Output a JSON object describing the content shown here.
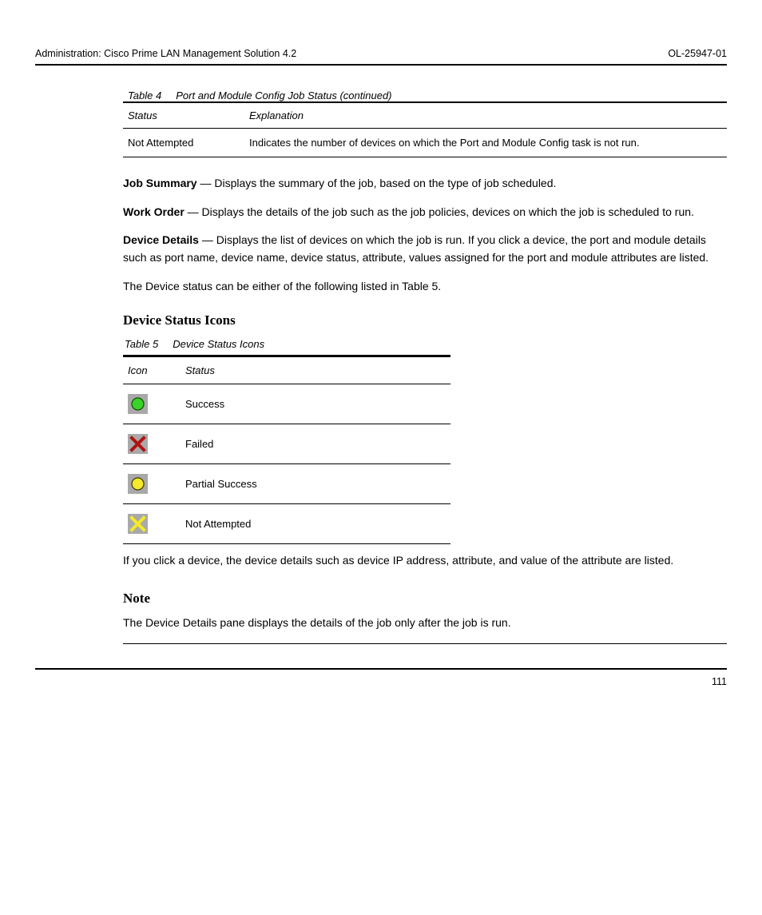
{
  "header": {
    "left": "Administration: Cisco Prime LAN Management Solution 4.2",
    "right": "OL-25947-01"
  },
  "table4": {
    "caption_prefix": "Table 4",
    "caption": "Port and Module Config Job Status (continued)",
    "columns": [
      "Status",
      "Explanation"
    ],
    "row": {
      "status": "Not Attempted",
      "explanation": "Indicates the number of devices on which the Port and Module Config task is not run."
    }
  },
  "paragraphs": [
    {
      "label": "Job Summary",
      "text": " — Displays the summary of the job, based on the type of job scheduled."
    },
    {
      "label": "Work Order",
      "text": " — Displays the details of the job such as the job policies, devices on which the job is scheduled to run."
    },
    {
      "label": "Device Details",
      "text": " — Displays the list of devices on which the job is run. If you click a device, the port and module details such as port name, device name, device status, attribute, values assigned for the port and module attributes are listed."
    },
    {
      "label": null,
      "text": "The Device status can be either of the following listed in Table 5."
    }
  ],
  "sections": {
    "iconTableHeading": "Device Status Icons",
    "iconTable": {
      "caption_prefix": "Table 5",
      "caption": "Device Status Icons",
      "columns": [
        "Icon",
        "Status"
      ],
      "rows": [
        {
          "icon": "green-circle",
          "status": "Success"
        },
        {
          "icon": "red-x",
          "status": "Failed"
        },
        {
          "icon": "yellow-circle",
          "status": "Partial Success"
        },
        {
          "icon": "yellow-x",
          "status": "Not Attempted"
        }
      ]
    }
  },
  "postTablePara": "If you click a device, the device details such as device IP address, attribute, and value of the attribute are listed.",
  "note": {
    "heading": "Note",
    "body": "The Device Details pane displays the details of the job only after the job is run."
  },
  "footer": {
    "right": "111"
  }
}
